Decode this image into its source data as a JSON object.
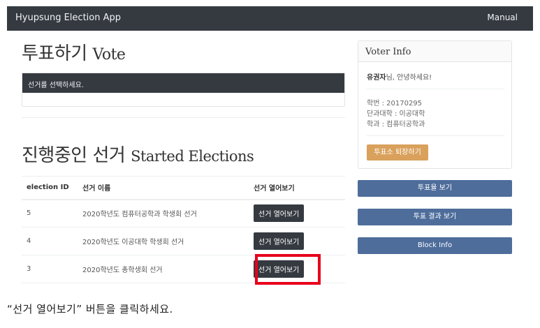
{
  "navbar": {
    "brand": "Hyupsung Election App",
    "manual": "Manual"
  },
  "vote": {
    "title_ko": "투표하기",
    "title_en": "Vote",
    "select_prompt": "선거를 선택하세요."
  },
  "started": {
    "title_ko": "진행중인 선거",
    "title_en": "Started Elections",
    "headers": [
      "election ID",
      "선거 이름",
      "선거 열어보기"
    ],
    "rows": [
      {
        "id": "5",
        "name": "2020학년도 컴퓨터공학과 학생회 선거",
        "button": "선거 열어보기"
      },
      {
        "id": "4",
        "name": "2020학년도 이공대학 학생회 선거",
        "button": "선거 열어보기"
      },
      {
        "id": "3",
        "name": "2020학년도 총학생회 선거",
        "button": "선거 열어보기"
      }
    ]
  },
  "voter": {
    "title": "Voter Info",
    "name": "유권자",
    "greeting_suffix": "님, 안녕하세요!",
    "student_id": "학번 : 20170295",
    "college": "단과대학 : 이공대학",
    "department": "학과 : 컴퓨터공학과",
    "exit_button": "투표소 퇴장하기"
  },
  "side_buttons": {
    "turnout": "투표율 보기",
    "results": "투표 결과 보기",
    "block_info": "Block Info"
  },
  "instruction": "“선거 열어보기” 버튼을 클릭하세요.",
  "colors": {
    "navbar": "#343a40",
    "primary": "#4e6d9b",
    "warning": "#d9a15b",
    "highlight": "#e8001c"
  }
}
